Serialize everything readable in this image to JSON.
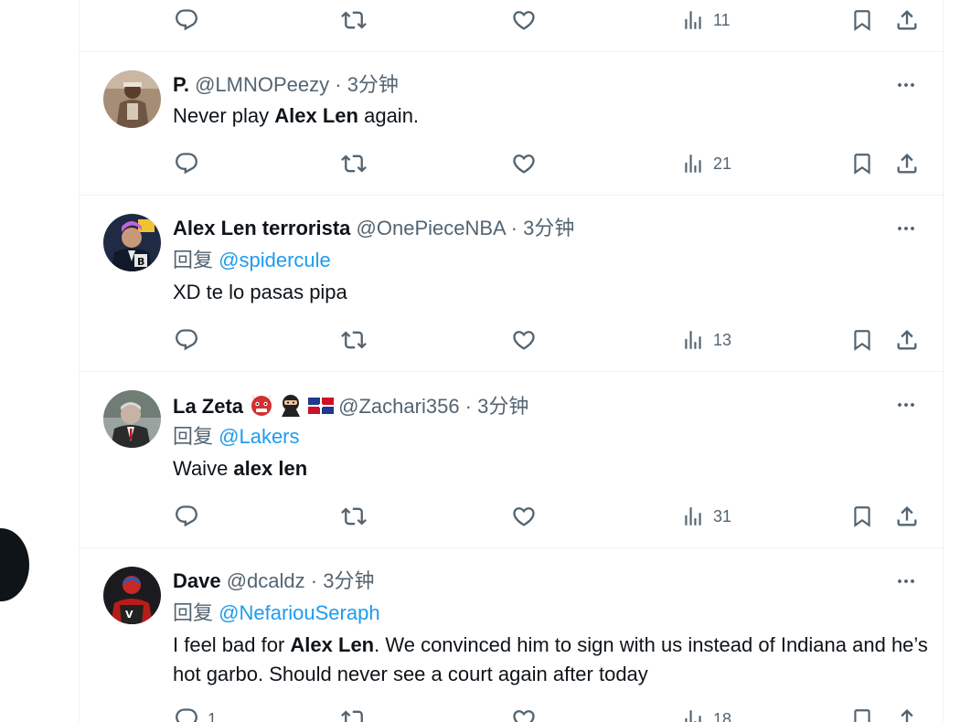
{
  "tweets": [
    {
      "views": "11",
      "reply_count": "",
      "retweet_count": "",
      "like_count": ""
    },
    {
      "display_name": "P.",
      "handle": "@LMNOPeezy",
      "time": "3分钟",
      "text_parts": [
        "Never play ",
        "Alex Len",
        " again."
      ],
      "views": "21"
    },
    {
      "display_name": "Alex Len terrorista",
      "handle": "@OnePieceNBA",
      "time": "3分钟",
      "reply_prefix": "回复",
      "reply_to": "@spidercule",
      "text": "XD te lo pasas pipa",
      "views": "13"
    },
    {
      "display_name": "La Zeta",
      "name_emojis": [
        "ogre-emoji",
        "ninja-emoji",
        "dominican-flag-emoji"
      ],
      "handle": "@Zachari356",
      "time": "3分钟",
      "reply_prefix": "回复",
      "reply_to": "@Lakers",
      "text_parts": [
        "Waive ",
        "alex len"
      ],
      "views": "31"
    },
    {
      "display_name": "Dave",
      "handle": "@dcaldz",
      "time": "3分钟",
      "reply_prefix": "回复",
      "reply_to": "@NefariouSeraph",
      "text_parts": [
        "I feel bad for ",
        "Alex Len",
        ". We convinced him to sign with us instead of Indiana and he’s hot garbo. Should never see a court again after today"
      ],
      "reply_count": "1",
      "views": "18"
    }
  ],
  "separator": " · ",
  "icons": {
    "reply": "reply-icon",
    "retweet": "retweet-icon",
    "like": "heart-icon",
    "views": "views-chart-icon",
    "bookmark": "bookmark-icon",
    "share": "share-icon",
    "more": "more-dots-icon"
  },
  "colors": {
    "link": "#1d9bf0",
    "muted": "#536471",
    "text": "#0f1419",
    "border": "#eff3f4"
  }
}
